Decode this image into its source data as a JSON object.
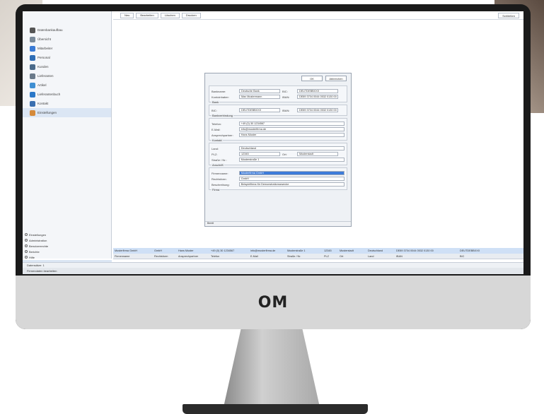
{
  "sidebar": {
    "items": [
      {
        "label": "Datenbankaufbau",
        "color": "#555555"
      },
      {
        "label": "Übersicht",
        "color": "#7a8a9a"
      },
      {
        "label": "Mitarbeiter",
        "color": "#3a7bd5"
      },
      {
        "label": "Personal",
        "color": "#2e6db5"
      },
      {
        "label": "Kunden",
        "color": "#4a6a8a"
      },
      {
        "label": "Lieferanten",
        "color": "#6a7a8a"
      },
      {
        "label": "Artikel",
        "color": "#3f8fd2"
      },
      {
        "label": "Lieferantenbuch",
        "color": "#2b78c8"
      },
      {
        "label": "Kontakt",
        "color": "#3a6fb0"
      },
      {
        "label": "Einstellungen",
        "color": "#d58a3a"
      }
    ],
    "radios": [
      "Einstellungen",
      "Administration",
      "Benutzerrechte",
      "Berichte",
      "Hilfe"
    ],
    "footer": "Einstellungen"
  },
  "toolbar": {
    "buttons": [
      "Neu",
      "Bearbeiten",
      "Löschen",
      "Drucken"
    ],
    "right": "Schließen"
  },
  "dialog": {
    "ok": "OK",
    "cancel": "Abbrechen",
    "sections": [
      {
        "title": "Bank",
        "rows": [
          [
            {
              "label": "Bankname:",
              "value": "Deutsche Bank"
            },
            {
              "label": "BIC:",
              "value": "DEUTDEBBXXX"
            }
          ],
          [
            {
              "label": "Kontoinhaber:",
              "value": "Max Mustermann"
            },
            {
              "label": "IBAN:",
              "value": "DE89 3704 0044 0532 0130 00"
            }
          ]
        ]
      },
      {
        "title": "Bankverbindung",
        "rows": [
          [
            {
              "label": "BIC:",
              "value": "DEUTDEBBXXX"
            },
            {
              "label": "IBAN:",
              "value": "DE89 3704 0044 0532 0130 00"
            }
          ]
        ]
      },
      {
        "title": "Kontakt",
        "rows": [
          [
            {
              "label": "Telefon:",
              "value": "+49 (0) 30 1234567"
            }
          ],
          [
            {
              "label": "E-Mail:",
              "value": "info@musterfirma.de"
            }
          ],
          [
            {
              "label": "Ansprechpartner:",
              "value": "Hans Muster"
            }
          ]
        ]
      },
      {
        "title": "Anschrift",
        "rows": [
          [
            {
              "label": "Land:",
              "value": "Deutschland"
            }
          ],
          [
            {
              "label": "PLZ:",
              "value": "12345"
            },
            {
              "label": "Ort:",
              "value": "Musterstadt"
            }
          ],
          [
            {
              "label": "Straße / Nr.:",
              "value": "Musterstraße 1"
            }
          ]
        ]
      },
      {
        "title": "Firma",
        "rows": [
          [
            {
              "label": "Firmenname:",
              "value": "Musterfirma GmbH",
              "selected": true
            }
          ],
          [
            {
              "label": "Rechtsform:",
              "value": "GmbH"
            }
          ],
          [
            {
              "label": "Beschreibung:",
              "value": "Beispielfirma für Demonstrationszwecke"
            }
          ]
        ]
      }
    ],
    "status": "Bereit"
  },
  "grid": {
    "headers": [
      "Firmenname",
      "Rechtsform",
      "Ansprechpartner",
      "Telefon",
      "E-Mail",
      "Straße / Nr.",
      "PLZ",
      "Ort",
      "Land",
      "IBAN",
      "BIC"
    ],
    "row": [
      "Musterfirma GmbH",
      "GmbH",
      "Hans Muster",
      "+49 (0) 30 1234567",
      "info@musterfirma.de",
      "Musterstraße 1",
      "12345",
      "Musterstadt",
      "Deutschland",
      "DE89 3704 0044 0532 0130 00",
      "DEUTDEBBXXX"
    ]
  },
  "bottombar": "Datensätze: 1",
  "statusbar": "Firmendaten bearbeiten",
  "brand": "OM"
}
